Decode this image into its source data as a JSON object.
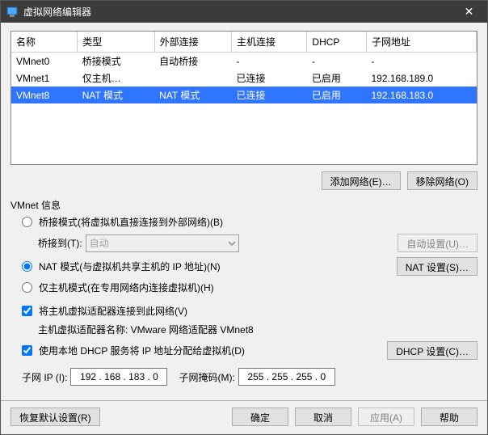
{
  "window": {
    "title": "虚拟网络编辑器"
  },
  "table": {
    "headers": {
      "name": "名称",
      "type": "类型",
      "external": "外部连接",
      "host": "主机连接",
      "dhcp": "DHCP",
      "subnet": "子网地址"
    },
    "rows": [
      {
        "name": "VMnet0",
        "type": "桥接模式",
        "external": "自动桥接",
        "host": "-",
        "dhcp": "-",
        "subnet": "-"
      },
      {
        "name": "VMnet1",
        "type": "仅主机…",
        "external": "",
        "host": "已连接",
        "dhcp": "已启用",
        "subnet": "192.168.189.0"
      },
      {
        "name": "VMnet8",
        "type": "NAT 模式",
        "external": "NAT 模式",
        "host": "已连接",
        "dhcp": "已启用",
        "subnet": "192.168.183.0"
      }
    ]
  },
  "buttons": {
    "add_network": "添加网络(E)…",
    "remove_network": "移除网络(O)"
  },
  "info": {
    "section_label": "VMnet 信息",
    "bridge_radio": "桥接模式(将虚拟机直接连接到外部网络)(B)",
    "bridge_to_label": "桥接到(T):",
    "bridge_to_value": "自动",
    "auto_settings": "自动设置(U)…",
    "nat_radio": "NAT 模式(与虚拟机共享主机的 IP 地址)(N)",
    "nat_settings": "NAT 设置(S)…",
    "hostonly_radio": "仅主机模式(在专用网络内连接虚拟机)(H)",
    "host_adapter_chk": "将主机虚拟适配器连接到此网络(V)",
    "host_adapter_name": "主机虚拟适配器名称: VMware 网络适配器 VMnet8",
    "dhcp_chk": "使用本地 DHCP 服务将 IP 地址分配给虚拟机(D)",
    "dhcp_settings": "DHCP 设置(C)…",
    "subnet_ip_label": "子网 IP (I):",
    "subnet_ip_value": "192 . 168 . 183 . 0",
    "subnet_mask_label": "子网掩码(M):",
    "subnet_mask_value": "255 . 255 . 255 . 0"
  },
  "footer": {
    "restore": "恢复默认设置(R)",
    "ok": "确定",
    "cancel": "取消",
    "apply": "应用(A)",
    "help": "帮助"
  }
}
